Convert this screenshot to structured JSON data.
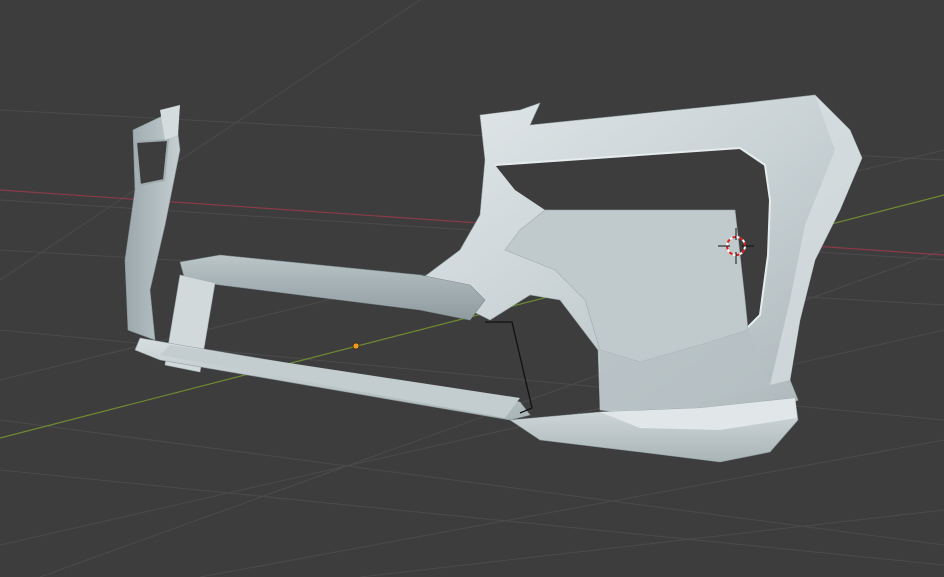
{
  "viewport": {
    "background": "#3d3d3d",
    "grid_color": "#4a4a4a",
    "x_axis_color": "#8a3b47",
    "y_axis_color": "#6e8a32"
  },
  "object": {
    "type": "mesh",
    "description_icon": "car-front-bumper-mesh",
    "base_color": "#c9d3d6",
    "shadow_color": "#8b989c",
    "highlight_color": "#e4eaec"
  },
  "overlays": {
    "cursor_icon": "3d-cursor-icon",
    "origin_icon": "object-origin-icon",
    "origin_color": "#f29a1f"
  }
}
